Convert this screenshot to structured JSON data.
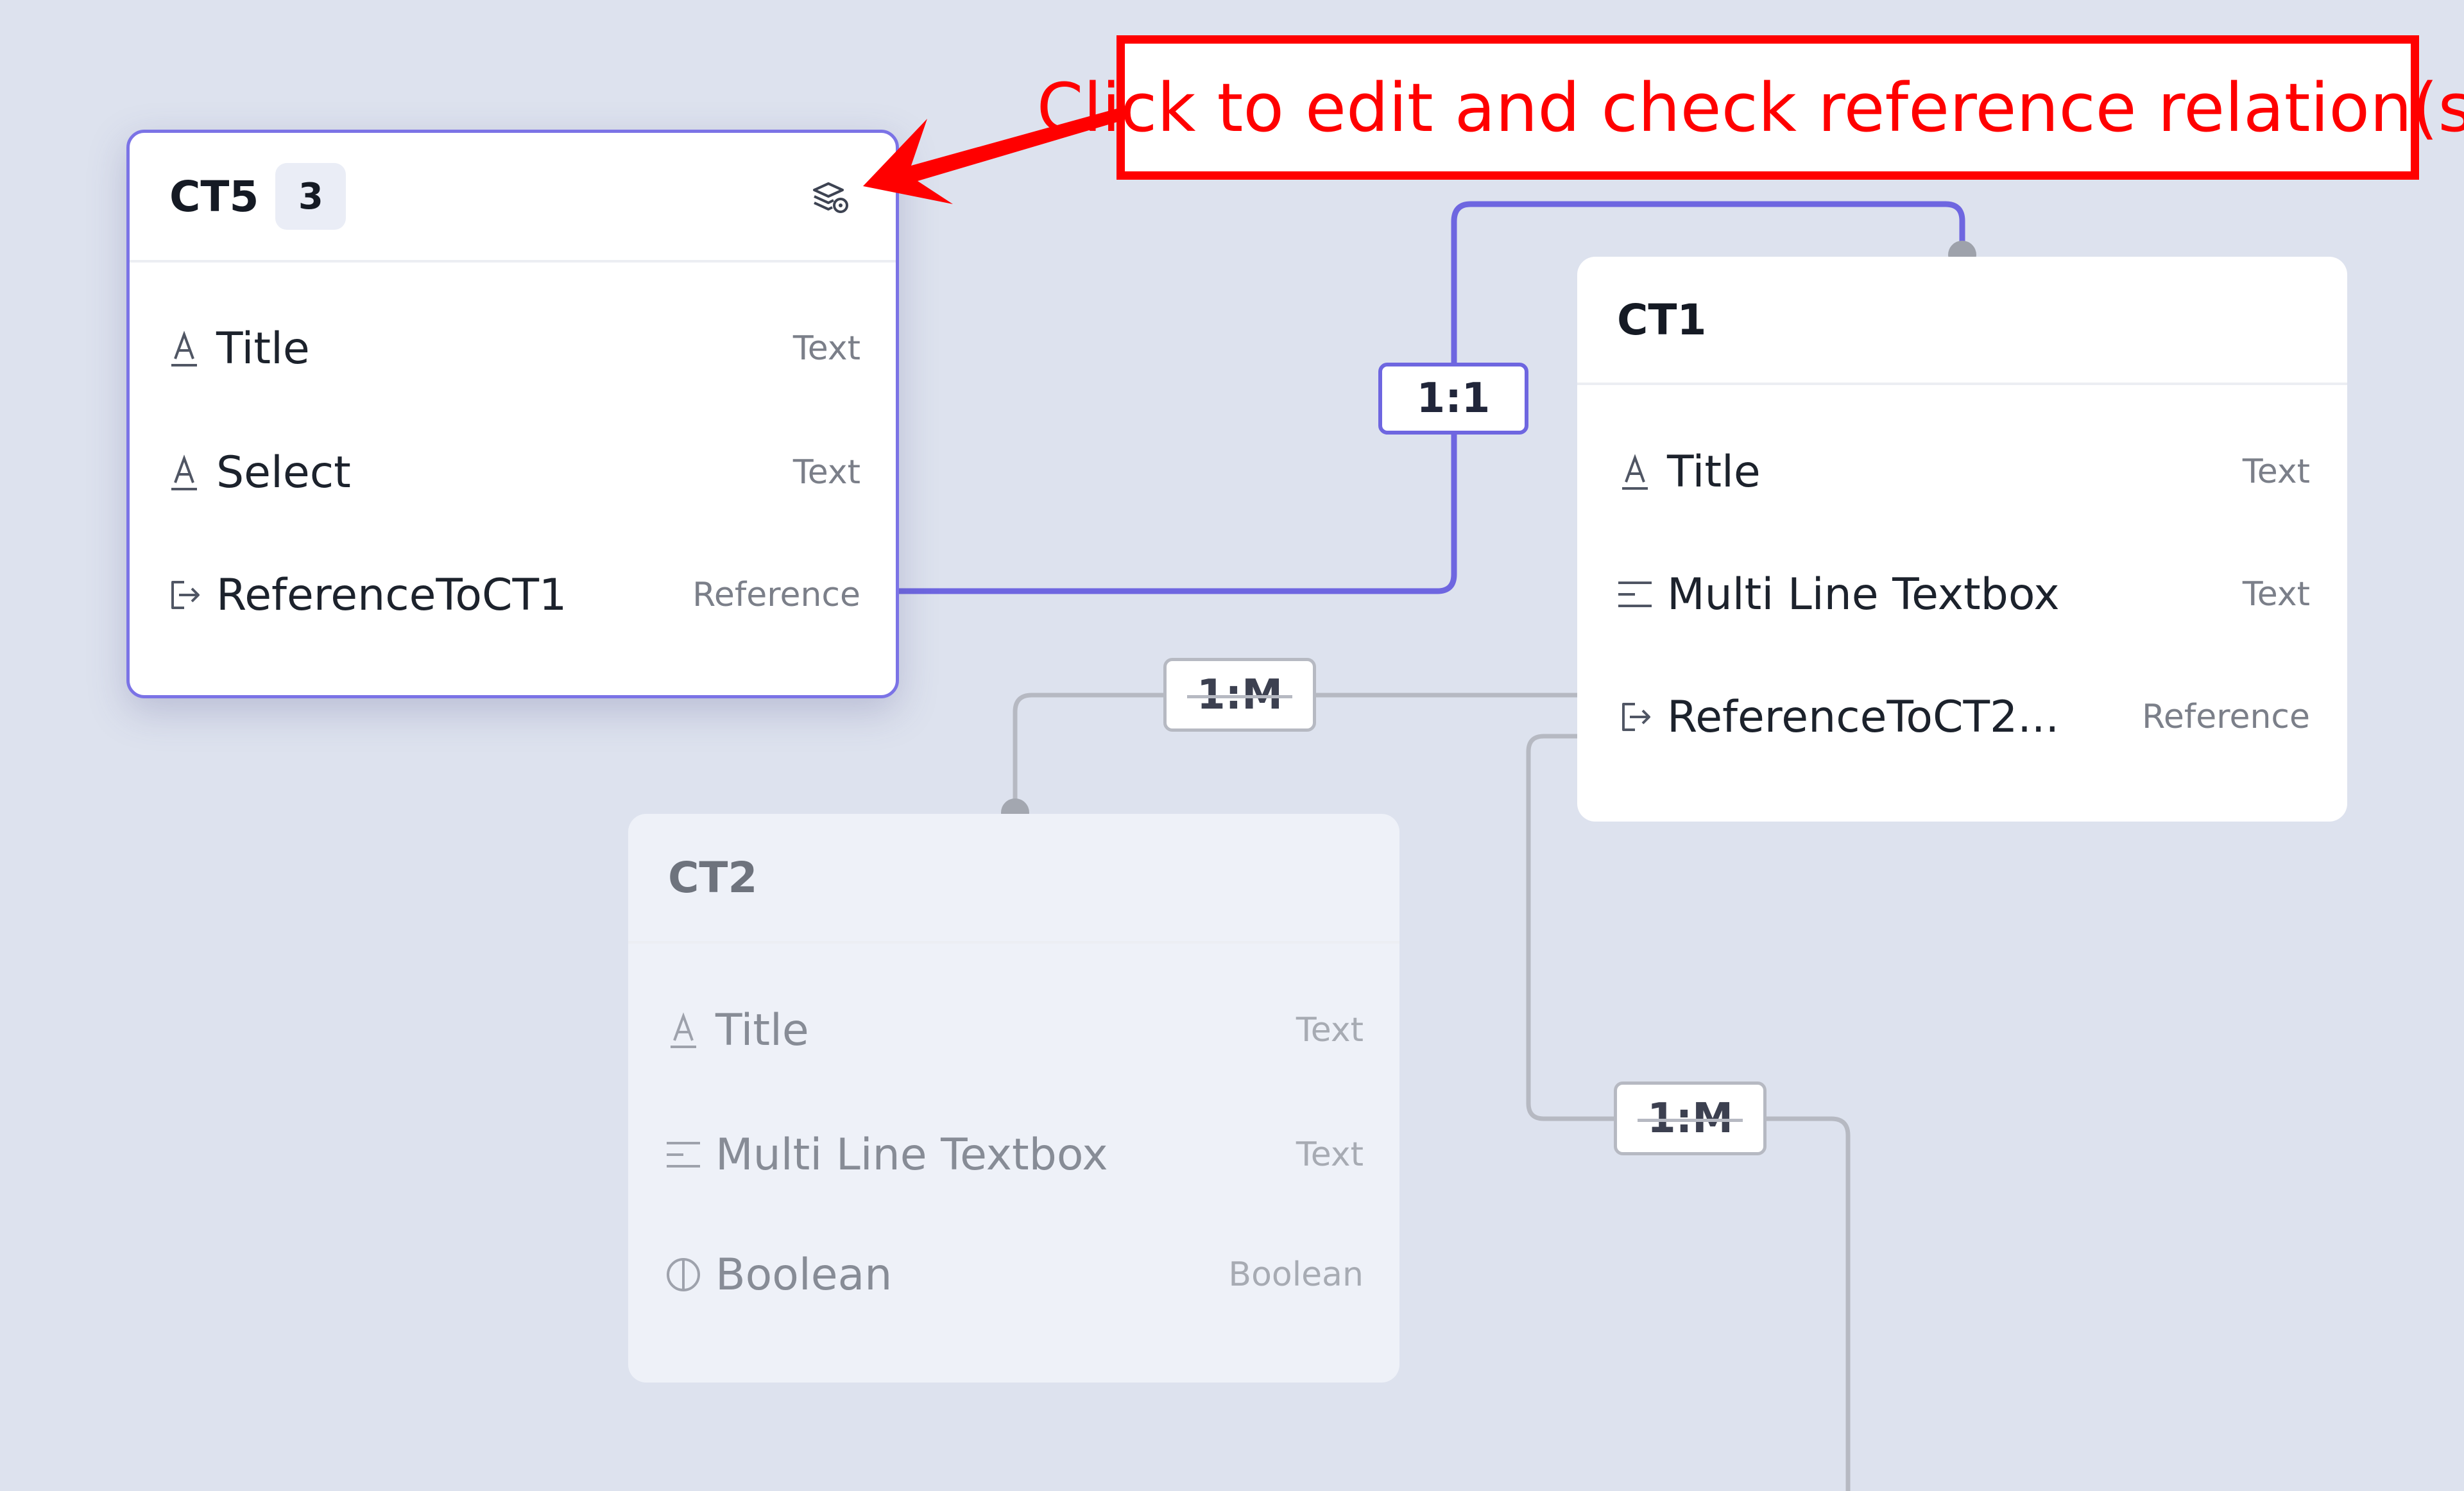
{
  "annotation": {
    "text": "Click to edit and check reference relation(s)"
  },
  "nodes": {
    "ct5": {
      "title": "CT5",
      "count": "3",
      "fields": [
        {
          "name": "Title",
          "type": "Text",
          "icon": "text-field-icon"
        },
        {
          "name": "Select",
          "type": "Text",
          "icon": "text-field-icon"
        },
        {
          "name": "ReferenceToCT1",
          "type": "Reference",
          "icon": "reference-field-icon"
        }
      ]
    },
    "ct1": {
      "title": "CT1",
      "fields": [
        {
          "name": "Title",
          "type": "Text",
          "icon": "text-field-icon"
        },
        {
          "name": "Multi Line Textbox",
          "type": "Text",
          "icon": "multiline-field-icon"
        },
        {
          "name": "ReferenceToCT2...",
          "type": "Reference",
          "icon": "reference-field-icon"
        }
      ]
    },
    "ct2": {
      "title": "CT2",
      "fields": [
        {
          "name": "Title",
          "type": "Text",
          "icon": "text-field-icon"
        },
        {
          "name": "Multi Line Textbox",
          "type": "Text",
          "icon": "multiline-field-icon"
        },
        {
          "name": "Boolean",
          "type": "Boolean",
          "icon": "boolean-field-icon"
        }
      ]
    }
  },
  "relations": {
    "ct5_ct1": "1:1",
    "ct1_ct2": "1:M",
    "ct1_other": "1:M"
  },
  "colors": {
    "canvas": "#dde2ee",
    "active_edge": "#6e66e0",
    "inactive_edge": "#b6b9c2",
    "annotation": "#ff0000"
  }
}
